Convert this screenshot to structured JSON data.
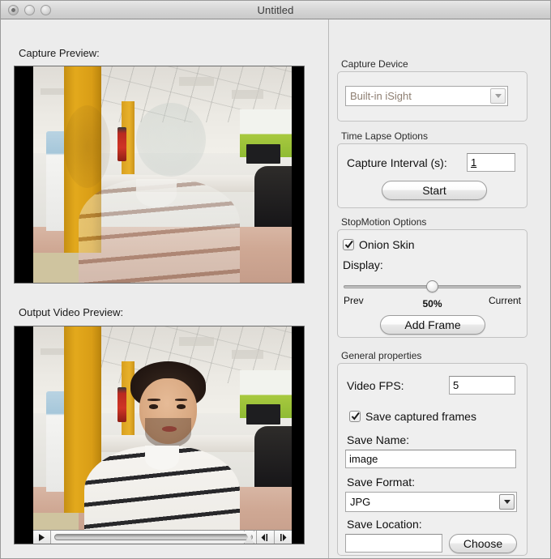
{
  "window": {
    "title": "Untitled",
    "traffic_lights": [
      "close-button",
      "minimize-button",
      "zoom-button"
    ]
  },
  "left_panel": {
    "capture_preview_label": "Capture Preview:",
    "output_preview_label": "Output Video Preview:",
    "player_controls": {
      "play_label": "play-button",
      "step_back_label": "step-back-button",
      "step_forward_label": "step-forward-button"
    }
  },
  "right_panel": {
    "capture_device": {
      "title": "Capture Device",
      "selected": "Built-in iSight",
      "enabled": false
    },
    "time_lapse": {
      "title": "Time Lapse Options",
      "interval_label": "Capture Interval (s):",
      "interval_value": "1",
      "start_button": "Start"
    },
    "stop_motion": {
      "title": "StopMotion Options",
      "onion_skin_label": "Onion Skin",
      "onion_skin_checked": true,
      "display_label": "Display:",
      "slider_min_label": "Prev",
      "slider_max_label": "Current",
      "slider_value": "50%",
      "slider_percent": 50,
      "add_frame_button": "Add Frame"
    },
    "general": {
      "title": "General properties",
      "video_fps_label": "Video FPS:",
      "video_fps_value": "5",
      "save_frames_label": "Save captured frames",
      "save_frames_checked": true,
      "save_name_label": "Save Name:",
      "save_name_value": "image",
      "save_format_label": "Save Format:",
      "save_format_value": "JPG",
      "save_location_label": "Save Location:",
      "save_location_value": "",
      "choose_button": "Choose"
    }
  },
  "colors": {
    "window_bg": "#ececec",
    "group_bg": "#efefef",
    "group_border": "#c2c2c2",
    "field_bg": "#ffffff",
    "disabled_text": "#8e7f72",
    "title_text": "#3a3a3a"
  }
}
